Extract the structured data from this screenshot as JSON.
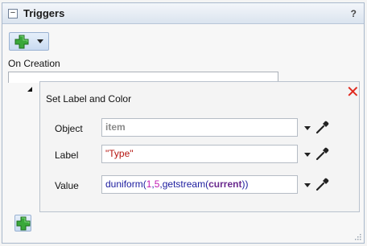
{
  "panel": {
    "title": "Triggers",
    "collapse_symbol": "−",
    "help_label": "?"
  },
  "toolbar": {
    "add_icon": "green-plus-icon",
    "dropdown_icon": "chevron-down-icon"
  },
  "section": {
    "label": "On Creation"
  },
  "trigger": {
    "title": "Set Label and Color",
    "close_icon": "red-x-icon",
    "fields": [
      {
        "label": "Object",
        "value": "item"
      },
      {
        "label": "Label",
        "value": "\"Type\""
      },
      {
        "label": "Value",
        "value": "duniform(1,5,getstream(current))"
      }
    ]
  },
  "colors": {
    "accent_blue": "#c9dbf1",
    "plus_green": "#3aa83a",
    "close_red": "#e0291e",
    "string_red": "#b5140f",
    "code_blue": "#1b1b9e",
    "number_magenta": "#c21bb5",
    "keyword_purple": "#6a2a8e"
  }
}
